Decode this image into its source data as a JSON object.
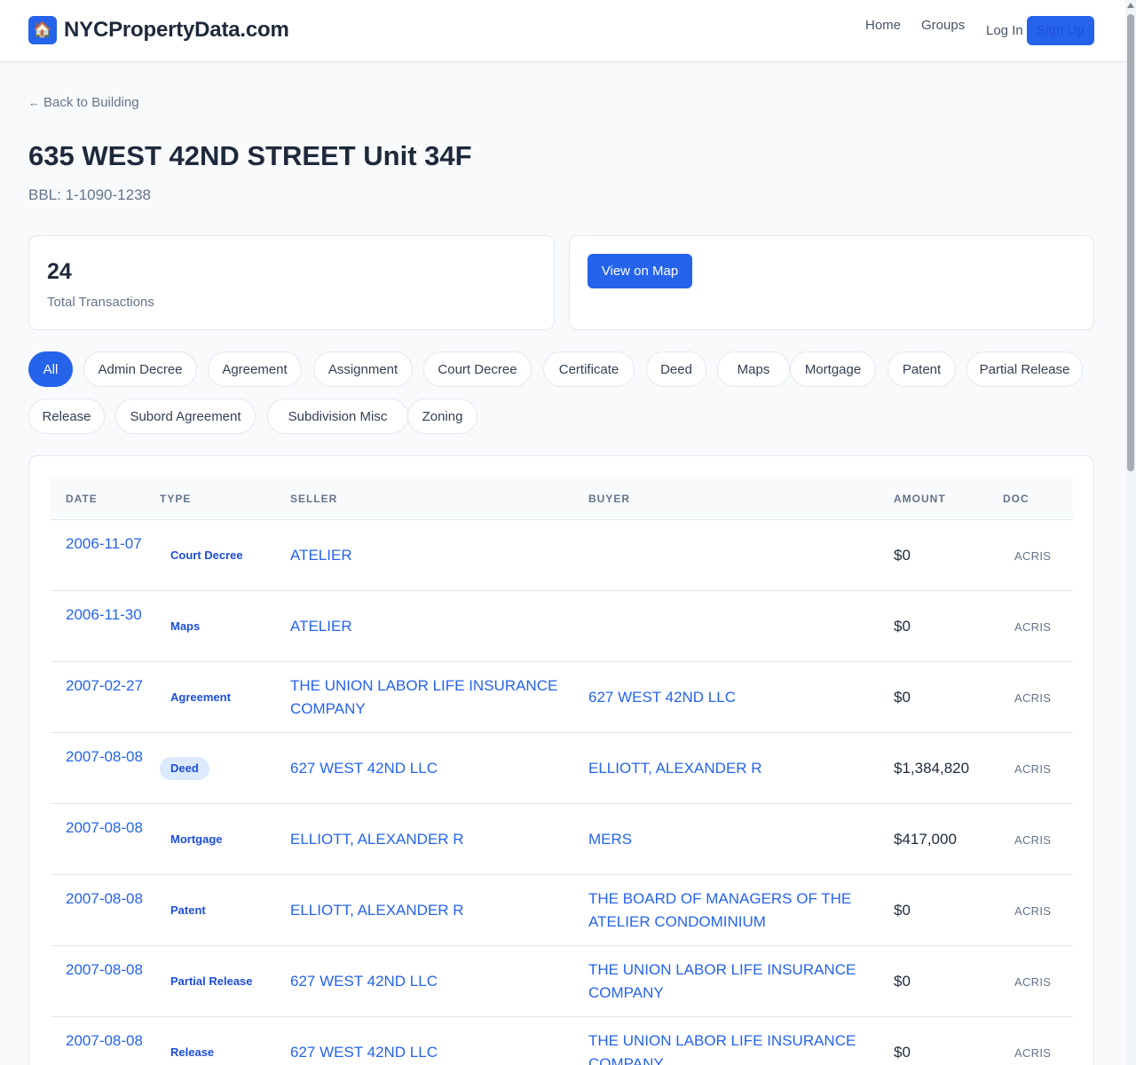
{
  "header": {
    "logo_icon": "🏠",
    "brand": "NYCPropertyData.com",
    "nav_home": "Home",
    "nav_groups": "Groups",
    "login": "Log In",
    "signup": "Sign Up"
  },
  "page": {
    "back_arrow": "←",
    "back_label": "Back to Building",
    "title": "635 WEST 42ND STREET Unit 34F",
    "bbl": "BBL: 1-1090-1238"
  },
  "stats": {
    "total_value": "24",
    "total_label": "Total Transactions",
    "map_button": "View on Map"
  },
  "filters": [
    "All",
    "Admin Decree",
    "Agreement",
    "Assignment",
    "Court Decree",
    "Certificate",
    "Deed",
    "Maps",
    "Mortgage",
    "Patent",
    "Partial Release",
    "Release",
    "Subord Agreement",
    "Subdivision Misc",
    "Zoning"
  ],
  "table": {
    "columns": [
      "DATE",
      "TYPE",
      "SELLER",
      "BUYER",
      "AMOUNT",
      "DOC"
    ],
    "rows": [
      {
        "date": "2006-11-07",
        "type": "Court Decree",
        "seller": "ATELIER",
        "buyer": "",
        "amount": "$0",
        "doc": "ACRIS"
      },
      {
        "date": "2006-11-30",
        "type": "Maps",
        "seller": "ATELIER",
        "buyer": "",
        "amount": "$0",
        "doc": "ACRIS"
      },
      {
        "date": "2007-02-27",
        "type": "Agreement",
        "seller": "THE UNION LABOR LIFE INSURANCE COMPANY",
        "buyer": "627 WEST 42ND LLC",
        "amount": "$0",
        "doc": "ACRIS"
      },
      {
        "date": "2007-08-08",
        "type": "Deed",
        "seller": "627 WEST 42ND LLC",
        "buyer": "ELLIOTT, ALEXANDER R",
        "amount": "$1,384,820",
        "doc": "ACRIS"
      },
      {
        "date": "2007-08-08",
        "type": "Mortgage",
        "seller": "ELLIOTT, ALEXANDER R",
        "buyer": "MERS",
        "amount": "$417,000",
        "doc": "ACRIS"
      },
      {
        "date": "2007-08-08",
        "type": "Patent",
        "seller": "ELLIOTT, ALEXANDER R",
        "buyer": "THE BOARD OF MANAGERS OF THE ATELIER CONDOMINIUM",
        "amount": "$0",
        "doc": "ACRIS"
      },
      {
        "date": "2007-08-08",
        "type": "Partial Release",
        "seller": "627 WEST 42ND LLC",
        "buyer": "THE UNION LABOR LIFE INSURANCE COMPANY",
        "amount": "$0",
        "doc": "ACRIS"
      },
      {
        "date": "2007-08-08",
        "type": "Release",
        "seller": "627 WEST 42ND LLC",
        "buyer": "THE UNION LABOR LIFE INSURANCE COMPANY",
        "amount": "$0",
        "doc": "ACRIS"
      }
    ]
  }
}
